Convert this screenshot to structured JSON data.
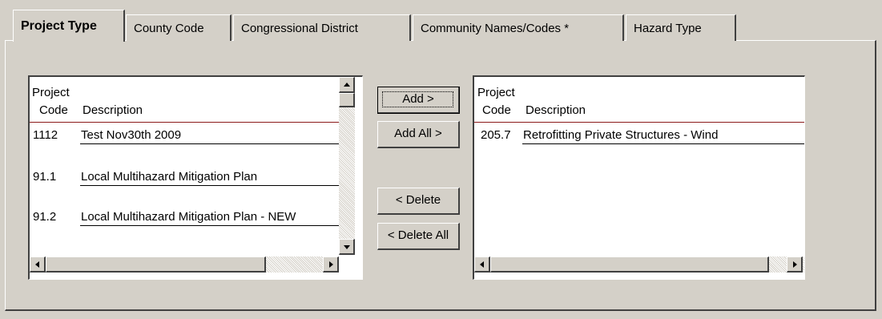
{
  "tabs": [
    {
      "label": "Project Type",
      "active": true
    },
    {
      "label": "County Code"
    },
    {
      "label": "Congressional District"
    },
    {
      "label": "Community Names/Codes *"
    },
    {
      "label": "Hazard Type"
    }
  ],
  "available_list": {
    "header_line1": "Project",
    "code_header": "Code",
    "description_header": "Description",
    "rows": [
      {
        "code": "1112",
        "description": "Test Nov30th 2009"
      },
      {
        "code": "91.1",
        "description": "Local Multihazard Mitigation Plan"
      },
      {
        "code": "91.2",
        "description": "Local Multihazard Mitigation Plan - NEW"
      }
    ]
  },
  "selected_list": {
    "header_line1": "Project",
    "code_header": "Code",
    "description_header": "Description",
    "rows": [
      {
        "code": "205.7",
        "description": "Retrofitting Private Structures - Wind"
      }
    ]
  },
  "buttons": {
    "add": "Add >",
    "add_all": "Add All >",
    "delete": "< Delete",
    "delete_all": "< Delete All"
  },
  "icons": {
    "scroll_up": "arrow-up-icon",
    "scroll_down": "arrow-down-icon",
    "scroll_left": "arrow-left-icon",
    "scroll_right": "arrow-right-icon"
  },
  "colors": {
    "background": "#d4d0c8",
    "header_rule": "#8b1a1a"
  }
}
